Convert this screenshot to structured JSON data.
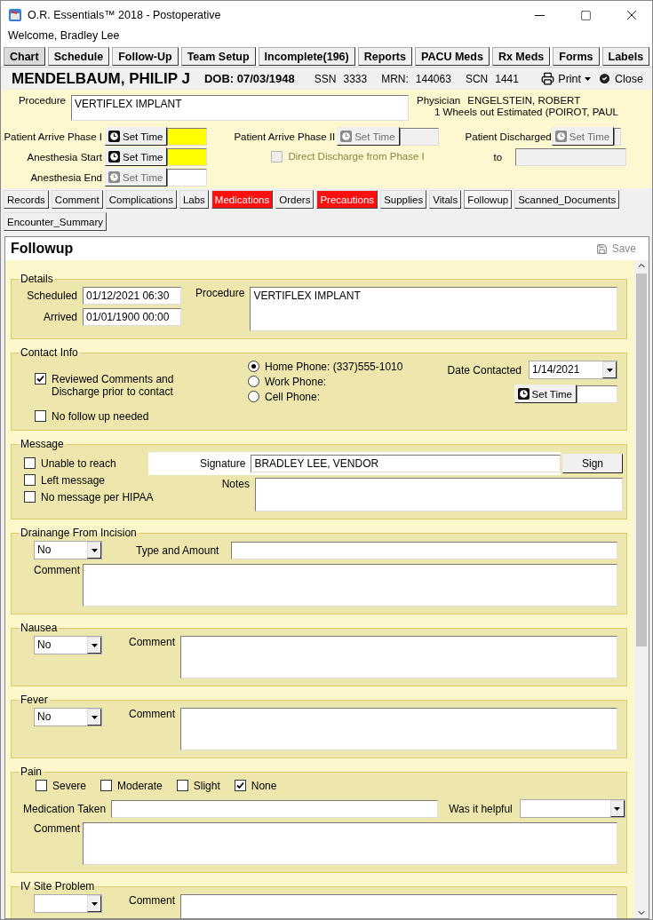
{
  "window": {
    "title": "O.R. Essentials™ 2018 - Postoperative"
  },
  "welcome": "Welcome, Bradley  Lee",
  "nav_tabs": [
    {
      "label": "Chart",
      "selected": true
    },
    {
      "label": "Schedule",
      "selected": false
    },
    {
      "label": "Follow-Up",
      "selected": false
    },
    {
      "label": "Team Setup",
      "selected": false
    },
    {
      "label": "Incomplete(196)",
      "selected": false
    },
    {
      "label": "Reports",
      "selected": false
    },
    {
      "label": "PACU Meds",
      "selected": false
    },
    {
      "label": "Rx Meds",
      "selected": false
    },
    {
      "label": "Forms",
      "selected": false
    },
    {
      "label": "Labels",
      "selected": false
    }
  ],
  "patient": {
    "name": "MENDELBAUM, PHILIP J",
    "dob": "DOB: 07/03/1948",
    "ssn_label": "SSN",
    "ssn": "3333",
    "mrn_label": "MRN:",
    "mrn": "144063",
    "scn_label": "SCN",
    "scn": "1441",
    "print": "Print",
    "close": "Close"
  },
  "case": {
    "procedure_label": "Procedure",
    "procedure": "VERTIFLEX IMPLANT",
    "physician_label": "Physician",
    "physician": "ENGELSTEIN, ROBERT",
    "wheels_label": "1 Wheels out Estimated (",
    "wheels_value": "POIROT, PAUL"
  },
  "phase1_times": [
    {
      "label": "Patient Arrive Phase I",
      "button": "Set Time",
      "disabled": false,
      "highlighted": true
    },
    {
      "label": "Anesthesia Start",
      "button": "Set Time",
      "disabled": false,
      "highlighted": true
    },
    {
      "label": "Anesthesia End",
      "button": "Set Time",
      "disabled": true,
      "highlighted": false
    }
  ],
  "phase2": {
    "label": "Patient Arrive Phase II",
    "button": "Set Time",
    "disabled": true,
    "checkbox": {
      "label": "Direct Discharge from Phase I",
      "checked": false,
      "disabled": true
    }
  },
  "discharge": {
    "label": "Patient Discharged",
    "button": "Set Time",
    "disabled": true,
    "to_label": "to"
  },
  "record_tabs": [
    {
      "label": "Records",
      "selected": false,
      "alert": false
    },
    {
      "label": "Comment",
      "selected": false,
      "alert": false
    },
    {
      "label": "Complications",
      "selected": false,
      "alert": false
    },
    {
      "label": "Labs",
      "selected": false,
      "alert": false
    },
    {
      "label": "Medications",
      "selected": false,
      "alert": true
    },
    {
      "label": "Orders",
      "selected": false,
      "alert": false
    },
    {
      "label": "Precautions",
      "selected": false,
      "alert": true
    },
    {
      "label": "Supplies",
      "selected": false,
      "alert": false
    },
    {
      "label": "Vitals",
      "selected": false,
      "alert": false
    },
    {
      "label": "Followup",
      "selected": true,
      "alert": false
    },
    {
      "label": "Scanned_Documents",
      "selected": false,
      "alert": false
    },
    {
      "label": "Encounter_Summary",
      "selected": false,
      "alert": false
    }
  ],
  "panel": {
    "title": "Followup",
    "save": "Save"
  },
  "details": {
    "title": "Details",
    "scheduled_label": "Scheduled",
    "scheduled": "01/12/2021 06:30",
    "arrived_label": "Arrived",
    "arrived": "01/01/1900 00:00",
    "procedure_label": "Procedure",
    "procedure": "VERTIFLEX IMPLANT"
  },
  "contact": {
    "title": "Contact Info",
    "checkboxes": [
      {
        "label": "Reviewed Comments and Discharge prior to contact",
        "checked": true
      },
      {
        "label": "No follow up needed",
        "checked": false
      }
    ],
    "phones": [
      {
        "label": "Home Phone: (337)555-1010",
        "selected": true
      },
      {
        "label": "Work Phone:",
        "selected": false
      },
      {
        "label": "Cell Phone:",
        "selected": false
      }
    ],
    "date_label": "Date Contacted",
    "date": "1/14/2021",
    "button": "Set Time"
  },
  "message": {
    "title": "Message",
    "checkboxes": [
      {
        "label": "Unable to reach",
        "checked": false
      },
      {
        "label": "Left message",
        "checked": false
      },
      {
        "label": "No message per HIPAA",
        "checked": false
      }
    ],
    "signature_label": "Signature",
    "signature": "BRADLEY LEE, VENDOR",
    "sign": "Sign",
    "notes_label": "Notes"
  },
  "drainage": {
    "title": "Drainange From Incision",
    "select": "No",
    "type_label": "Type and Amount",
    "comment_label": "Comment"
  },
  "nausea": {
    "title": "Nausea",
    "select": "No",
    "comment_label": "Comment"
  },
  "fever": {
    "title": "Fever",
    "select": "No",
    "comment_label": "Comment"
  },
  "pain": {
    "title": "Pain",
    "levels": [
      {
        "label": "Severe",
        "checked": false
      },
      {
        "label": "Moderate",
        "checked": false
      },
      {
        "label": "Slight",
        "checked": false
      },
      {
        "label": "None",
        "checked": true
      }
    ],
    "medication_label": "Medication Taken",
    "helpful_label": "Was it helpful",
    "comment_label": "Comment"
  },
  "iv_site": {
    "title": "IV Site Problem",
    "comment_label": "Comment"
  }
}
